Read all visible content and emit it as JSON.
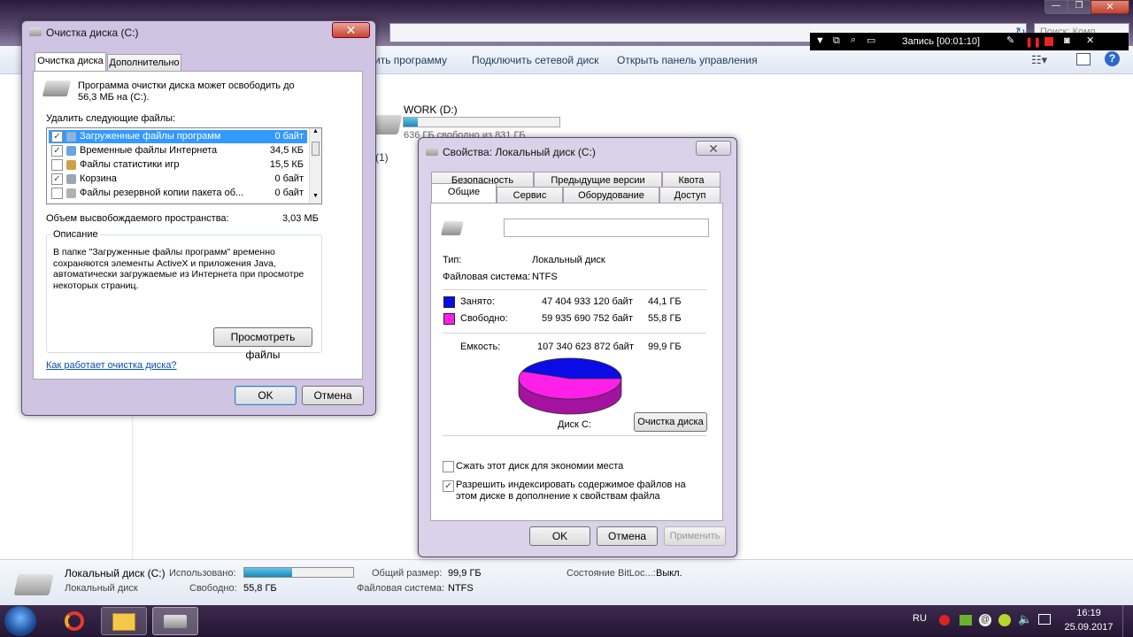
{
  "explorer": {
    "search_placeholder": "Поиск: Комп...",
    "toolbar": [
      "ить программу",
      "Подключить сетевой диск",
      "Открыть панель управления"
    ],
    "drive_d": {
      "name": "WORK (D:)",
      "free_text": "636 ГБ свободно из 831 ГБ",
      "usage_fraction": 0.09
    },
    "partial_count": "(1)",
    "details": {
      "name": "Локальный диск (C:)",
      "type": "Локальный диск",
      "used_label": "Использовано:",
      "free_label": "Свободно:",
      "free_value": "55,8 ГБ",
      "total_label": "Общий размер:",
      "total_value": "99,9 ГБ",
      "fs_label": "Файловая система:",
      "fs_value": "NTFS",
      "bitlocker_label": "Состояние BitLoc...:",
      "bitlocker_value": "Выкл.",
      "usage_fraction": 0.44
    }
  },
  "recorder": {
    "status": "Запись [00:01:10]"
  },
  "cleanup": {
    "title": "Очистка диска  (C:)",
    "tabs": [
      "Очистка диска",
      "Дополнительно"
    ],
    "intro": "Программа очистки диска может освободить до 56,3 МБ на  (C:).",
    "delete_label": "Удалить следующие файлы:",
    "files": [
      {
        "name": "Загруженные файлы программ",
        "size": "0 байт",
        "checked": true
      },
      {
        "name": "Временные файлы Интернета",
        "size": "34,5 КБ",
        "checked": true
      },
      {
        "name": "Файлы статистики игр",
        "size": "15,5 КБ",
        "checked": false
      },
      {
        "name": "Корзина",
        "size": "0 байт",
        "checked": true
      },
      {
        "name": "Файлы резервной копии пакета об...",
        "size": "0 байт",
        "checked": false
      }
    ],
    "space_label": "Объем высвобождаемого пространства:",
    "space_value": "3,03 МБ",
    "description_title": "Описание",
    "description": "В папке \"Загруженные файлы программ\" временно сохраняются элементы ActiveX и приложения Java, автоматически загружаемые из Интернета при просмотре некоторых страниц.",
    "view_files": "Просмотреть файлы",
    "help_link": "Как работает очистка диска?",
    "ok": "OK",
    "cancel": "Отмена"
  },
  "props": {
    "title": "Свойства: Локальный диск (C:)",
    "tabs_row1": [
      "Безопасность",
      "Предыдущие версии",
      "Квота"
    ],
    "tabs_row2": [
      "Общие",
      "Сервис",
      "Оборудование",
      "Доступ"
    ],
    "type_label": "Тип:",
    "type_value": "Локальный диск",
    "fs_label": "Файловая система:",
    "fs_value": "NTFS",
    "used_label": "Занято:",
    "used_bytes": "47 404 933 120 байт",
    "used_gb": "44,1 ГБ",
    "used_color": "#0b0be6",
    "free_label": "Свободно:",
    "free_bytes": "59 935 690 752 байт",
    "free_gb": "55,8 ГБ",
    "free_color": "#ff1fe8",
    "cap_label": "Емкость:",
    "cap_bytes": "107 340 623 872 байт",
    "cap_gb": "99,9 ГБ",
    "used_fraction": 0.4416,
    "disk_label": "Диск С:",
    "cleanup_btn": "Очистка диска",
    "compress": "Сжать этот диск для экономии места",
    "index": "Разрешить индексировать содержимое файлов на этом диске в дополнение к свойствам файла",
    "ok": "OK",
    "cancel": "Отмена",
    "apply": "Применить"
  },
  "taskbar": {
    "lang": "RU",
    "time": "16:19",
    "date": "25.09.2017"
  }
}
